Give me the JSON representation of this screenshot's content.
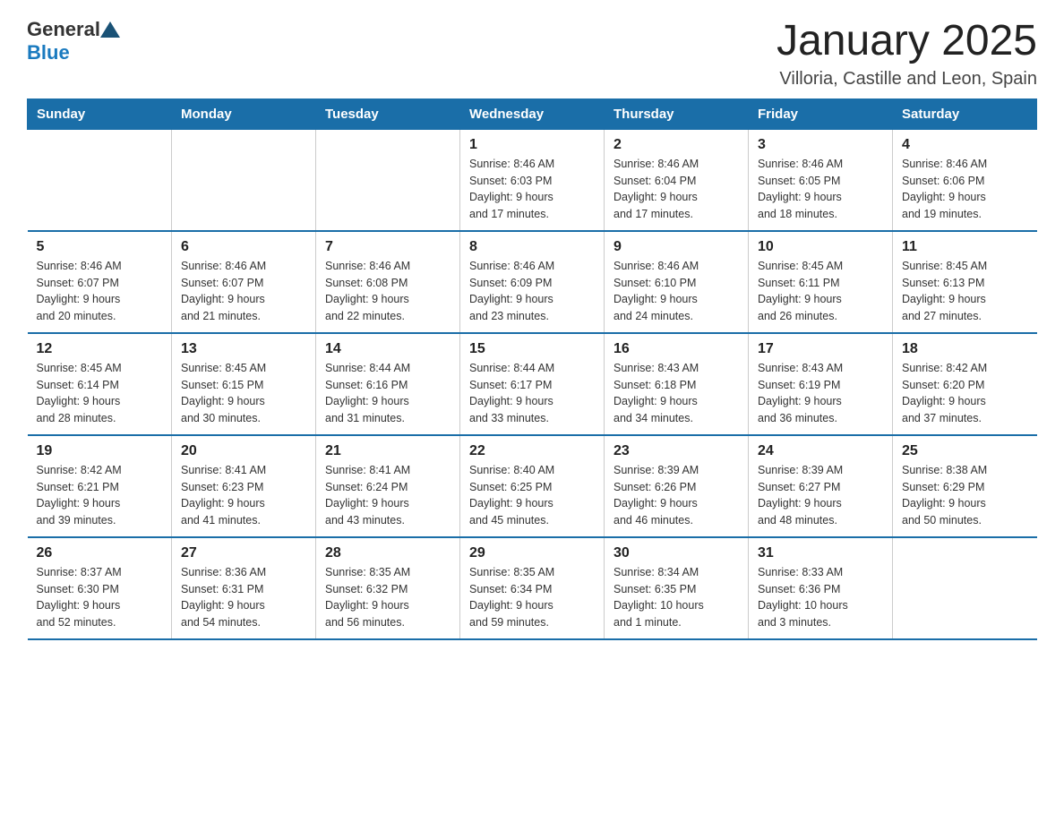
{
  "header": {
    "title": "January 2025",
    "subtitle": "Villoria, Castille and Leon, Spain",
    "logo_general": "General",
    "logo_blue": "Blue"
  },
  "days_of_week": [
    "Sunday",
    "Monday",
    "Tuesday",
    "Wednesday",
    "Thursday",
    "Friday",
    "Saturday"
  ],
  "weeks": [
    [
      {
        "day": "",
        "info": ""
      },
      {
        "day": "",
        "info": ""
      },
      {
        "day": "",
        "info": ""
      },
      {
        "day": "1",
        "info": "Sunrise: 8:46 AM\nSunset: 6:03 PM\nDaylight: 9 hours\nand 17 minutes."
      },
      {
        "day": "2",
        "info": "Sunrise: 8:46 AM\nSunset: 6:04 PM\nDaylight: 9 hours\nand 17 minutes."
      },
      {
        "day": "3",
        "info": "Sunrise: 8:46 AM\nSunset: 6:05 PM\nDaylight: 9 hours\nand 18 minutes."
      },
      {
        "day": "4",
        "info": "Sunrise: 8:46 AM\nSunset: 6:06 PM\nDaylight: 9 hours\nand 19 minutes."
      }
    ],
    [
      {
        "day": "5",
        "info": "Sunrise: 8:46 AM\nSunset: 6:07 PM\nDaylight: 9 hours\nand 20 minutes."
      },
      {
        "day": "6",
        "info": "Sunrise: 8:46 AM\nSunset: 6:07 PM\nDaylight: 9 hours\nand 21 minutes."
      },
      {
        "day": "7",
        "info": "Sunrise: 8:46 AM\nSunset: 6:08 PM\nDaylight: 9 hours\nand 22 minutes."
      },
      {
        "day": "8",
        "info": "Sunrise: 8:46 AM\nSunset: 6:09 PM\nDaylight: 9 hours\nand 23 minutes."
      },
      {
        "day": "9",
        "info": "Sunrise: 8:46 AM\nSunset: 6:10 PM\nDaylight: 9 hours\nand 24 minutes."
      },
      {
        "day": "10",
        "info": "Sunrise: 8:45 AM\nSunset: 6:11 PM\nDaylight: 9 hours\nand 26 minutes."
      },
      {
        "day": "11",
        "info": "Sunrise: 8:45 AM\nSunset: 6:13 PM\nDaylight: 9 hours\nand 27 minutes."
      }
    ],
    [
      {
        "day": "12",
        "info": "Sunrise: 8:45 AM\nSunset: 6:14 PM\nDaylight: 9 hours\nand 28 minutes."
      },
      {
        "day": "13",
        "info": "Sunrise: 8:45 AM\nSunset: 6:15 PM\nDaylight: 9 hours\nand 30 minutes."
      },
      {
        "day": "14",
        "info": "Sunrise: 8:44 AM\nSunset: 6:16 PM\nDaylight: 9 hours\nand 31 minutes."
      },
      {
        "day": "15",
        "info": "Sunrise: 8:44 AM\nSunset: 6:17 PM\nDaylight: 9 hours\nand 33 minutes."
      },
      {
        "day": "16",
        "info": "Sunrise: 8:43 AM\nSunset: 6:18 PM\nDaylight: 9 hours\nand 34 minutes."
      },
      {
        "day": "17",
        "info": "Sunrise: 8:43 AM\nSunset: 6:19 PM\nDaylight: 9 hours\nand 36 minutes."
      },
      {
        "day": "18",
        "info": "Sunrise: 8:42 AM\nSunset: 6:20 PM\nDaylight: 9 hours\nand 37 minutes."
      }
    ],
    [
      {
        "day": "19",
        "info": "Sunrise: 8:42 AM\nSunset: 6:21 PM\nDaylight: 9 hours\nand 39 minutes."
      },
      {
        "day": "20",
        "info": "Sunrise: 8:41 AM\nSunset: 6:23 PM\nDaylight: 9 hours\nand 41 minutes."
      },
      {
        "day": "21",
        "info": "Sunrise: 8:41 AM\nSunset: 6:24 PM\nDaylight: 9 hours\nand 43 minutes."
      },
      {
        "day": "22",
        "info": "Sunrise: 8:40 AM\nSunset: 6:25 PM\nDaylight: 9 hours\nand 45 minutes."
      },
      {
        "day": "23",
        "info": "Sunrise: 8:39 AM\nSunset: 6:26 PM\nDaylight: 9 hours\nand 46 minutes."
      },
      {
        "day": "24",
        "info": "Sunrise: 8:39 AM\nSunset: 6:27 PM\nDaylight: 9 hours\nand 48 minutes."
      },
      {
        "day": "25",
        "info": "Sunrise: 8:38 AM\nSunset: 6:29 PM\nDaylight: 9 hours\nand 50 minutes."
      }
    ],
    [
      {
        "day": "26",
        "info": "Sunrise: 8:37 AM\nSunset: 6:30 PM\nDaylight: 9 hours\nand 52 minutes."
      },
      {
        "day": "27",
        "info": "Sunrise: 8:36 AM\nSunset: 6:31 PM\nDaylight: 9 hours\nand 54 minutes."
      },
      {
        "day": "28",
        "info": "Sunrise: 8:35 AM\nSunset: 6:32 PM\nDaylight: 9 hours\nand 56 minutes."
      },
      {
        "day": "29",
        "info": "Sunrise: 8:35 AM\nSunset: 6:34 PM\nDaylight: 9 hours\nand 59 minutes."
      },
      {
        "day": "30",
        "info": "Sunrise: 8:34 AM\nSunset: 6:35 PM\nDaylight: 10 hours\nand 1 minute."
      },
      {
        "day": "31",
        "info": "Sunrise: 8:33 AM\nSunset: 6:36 PM\nDaylight: 10 hours\nand 3 minutes."
      },
      {
        "day": "",
        "info": ""
      }
    ]
  ]
}
